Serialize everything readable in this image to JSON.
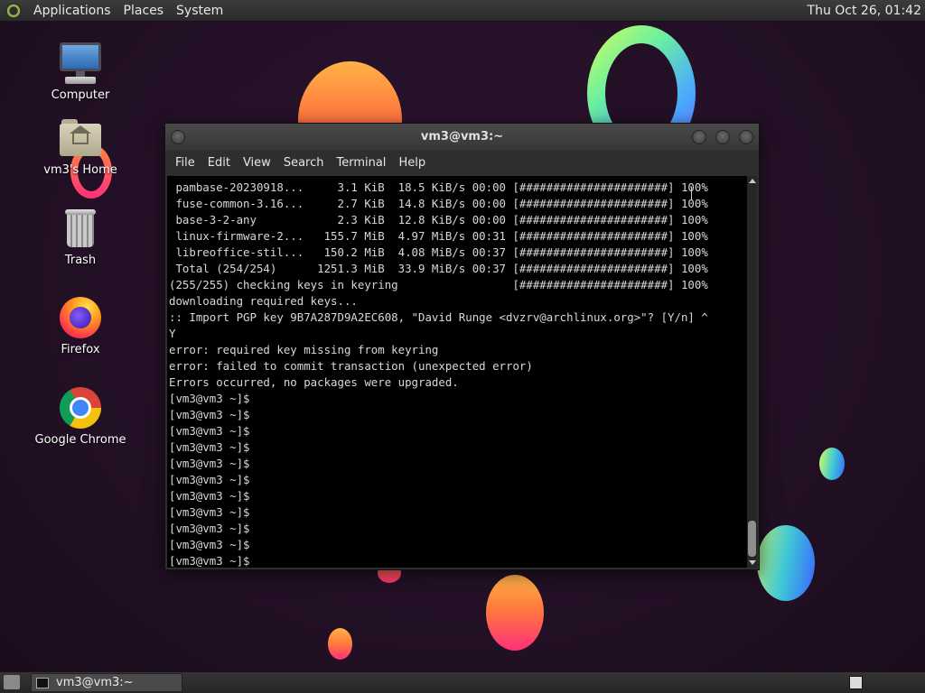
{
  "top_panel": {
    "menus": [
      "Applications",
      "Places",
      "System"
    ],
    "clock": "Thu Oct 26, 01:42"
  },
  "desktop_icons": [
    {
      "label": "Computer",
      "icon": "computer-icon"
    },
    {
      "label": "vm3's Home",
      "icon": "home-folder-icon"
    },
    {
      "label": "Trash",
      "icon": "trash-icon"
    },
    {
      "label": "Firefox",
      "icon": "firefox-icon"
    },
    {
      "label": "Google Chrome",
      "icon": "chrome-icon"
    }
  ],
  "terminal": {
    "title": "vm3@vm3:~",
    "menus": [
      "File",
      "Edit",
      "View",
      "Search",
      "Terminal",
      "Help"
    ],
    "lines": [
      " pambase-20230918...     3.1 KiB  18.5 KiB/s 00:00 [######################] 100%",
      " fuse-common-3.16...     2.7 KiB  14.8 KiB/s 00:00 [######################] 100%",
      " base-3-2-any            2.3 KiB  12.8 KiB/s 00:00 [######################] 100%",
      " linux-firmware-2...   155.7 MiB  4.97 MiB/s 00:31 [######################] 100%",
      " libreoffice-stil...   150.2 MiB  4.08 MiB/s 00:37 [######################] 100%",
      " Total (254/254)      1251.3 MiB  33.9 MiB/s 00:37 [######################] 100%",
      "(255/255) checking keys in keyring                 [######################] 100%",
      "downloading required keys...",
      ":: Import PGP key 9B7A287D9A2EC608, \"David Runge <dvzrv@archlinux.org>\"? [Y/n] ^",
      "Y",
      "error: required key missing from keyring",
      "error: failed to commit transaction (unexpected error)",
      "Errors occurred, no packages were upgraded.",
      "[vm3@vm3 ~]$",
      "[vm3@vm3 ~]$",
      "[vm3@vm3 ~]$",
      "[vm3@vm3 ~]$",
      "[vm3@vm3 ~]$",
      "[vm3@vm3 ~]$",
      "[vm3@vm3 ~]$",
      "[vm3@vm3 ~]$",
      "[vm3@vm3 ~]$",
      "[vm3@vm3 ~]$",
      "[vm3@vm3 ~]$"
    ]
  },
  "taskbar": {
    "task_label": "vm3@vm3:~"
  },
  "colors": {
    "terminal_bg": "#000000",
    "terminal_text": "#d8d8d8",
    "panel_bg": "#2b2b2b"
  }
}
